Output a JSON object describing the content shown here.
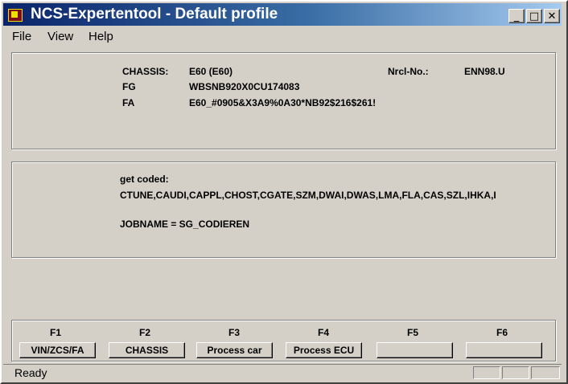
{
  "window": {
    "title": "NCS-Expertentool - Default profile"
  },
  "menu": [
    "File",
    "View",
    "Help"
  ],
  "info_panel": {
    "chassis_label": "CHASSIS:",
    "chassis_value": "E60 (E60)",
    "nrcl_label": "Nrcl-No.:",
    "nrcl_value": "ENN98.U",
    "fg_label": "FG",
    "fg_value": "WBSNB920X0CU174083",
    "fa_label": "FA",
    "fa_value": "E60_#0905&X3A9%0A30*NB92$216$261!"
  },
  "job_panel": {
    "heading": "get coded:",
    "modules": "CTUNE,CAUDI,CAPPL,CHOST,CGATE,SZM,DWAI,DWAS,LMA,FLA,CAS,SZL,IHKA,I",
    "jobname": "JOBNAME = SG_CODIEREN"
  },
  "function_keys": [
    {
      "key": "F1",
      "label": "VIN/ZCS/FA"
    },
    {
      "key": "F2",
      "label": "CHASSIS"
    },
    {
      "key": "F3",
      "label": "Process car"
    },
    {
      "key": "F4",
      "label": "Process ECU"
    },
    {
      "key": "F5",
      "label": ""
    },
    {
      "key": "F6",
      "label": ""
    }
  ],
  "status": {
    "text": "Ready"
  },
  "colors": {
    "window_bg": "#d4d0c8",
    "titlebar_start": "#0a246a",
    "titlebar_end": "#a6caf0"
  }
}
